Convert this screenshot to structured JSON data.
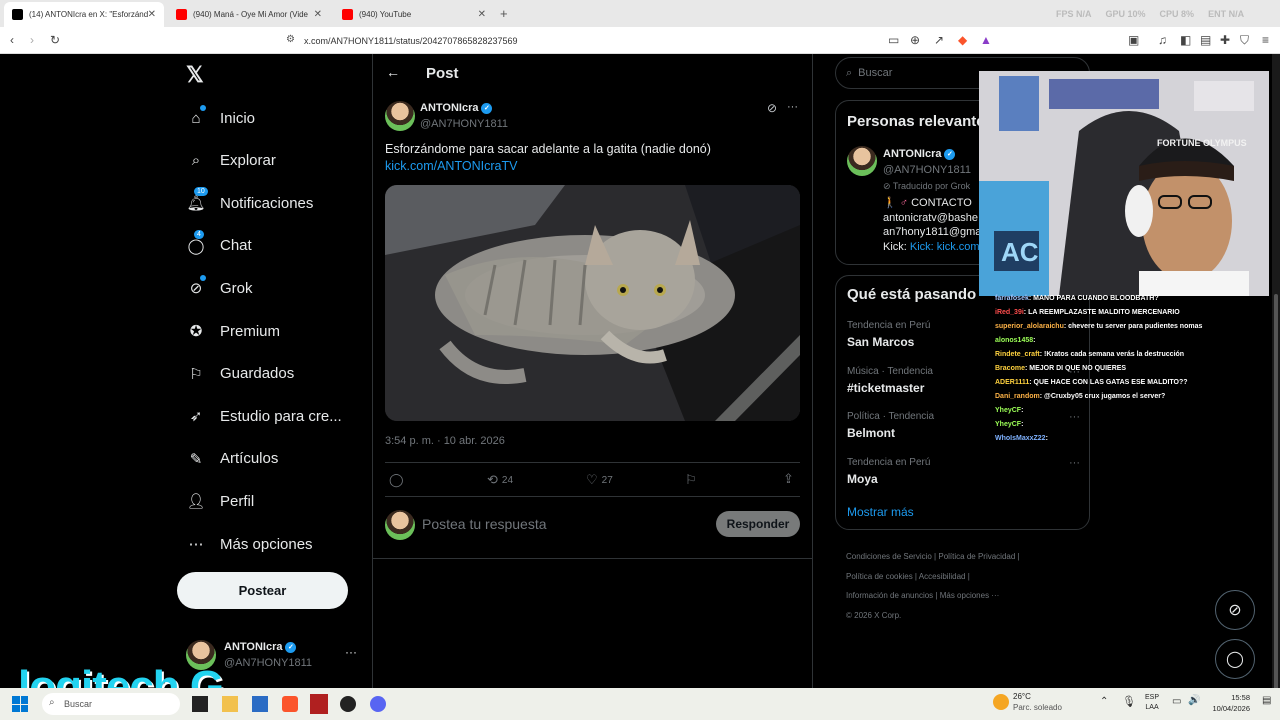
{
  "browser": {
    "tabs": [
      {
        "title": "(14) ANTONIcra en X: \"Esforzánd",
        "active": true,
        "favicon_color": "#000000"
      },
      {
        "title": "(940) Maná - Oye Mi Amor (Vide",
        "active": false,
        "favicon_color": "#ff0000"
      },
      {
        "title": "(940) YouTube",
        "active": false,
        "favicon_color": "#ff0000"
      }
    ],
    "new_tab": "+",
    "url": "x.com/AN7HONY1811/status/2042707865828237569",
    "perf": [
      "FPS N/A",
      "GPU 10%",
      "CPU 8%",
      "ENT N/A"
    ]
  },
  "nav": {
    "items": [
      {
        "label": "Inicio",
        "icon": "home-icon",
        "dot": true
      },
      {
        "label": "Explorar",
        "icon": "search-icon"
      },
      {
        "label": "Notificaciones",
        "icon": "bell-icon",
        "badge": "10"
      },
      {
        "label": "Chat",
        "icon": "chat-icon",
        "badge": "4"
      },
      {
        "label": "Grok",
        "icon": "grok-icon",
        "dot": true
      },
      {
        "label": "Premium",
        "icon": "premium-icon"
      },
      {
        "label": "Guardados",
        "icon": "bookmark-icon"
      },
      {
        "label": "Estudio para cre...",
        "icon": "rocket-icon"
      },
      {
        "label": "Artículos",
        "icon": "article-icon"
      },
      {
        "label": "Perfil",
        "icon": "person-icon"
      },
      {
        "label": "Más opciones",
        "icon": "more-icon"
      }
    ],
    "post_button": "Postear",
    "account": {
      "name": "ANTONIcra",
      "handle": "@AN7HONY1811"
    }
  },
  "post": {
    "header": "Post",
    "author": "ANTONIcra",
    "handle": "@AN7HONY1811",
    "text": "Esforzándome para sacar adelante a la gatita (nadie donó)",
    "link": "kick.com/ANTONIcraTV",
    "timestamp": "3:54 p. m. · 10 abr. 2026",
    "retweets": "24",
    "likes": "27",
    "reply_placeholder": "Postea tu respuesta",
    "reply_button": "Responder"
  },
  "sidebar": {
    "search_placeholder": "Buscar",
    "relevant_title": "Personas relevantes",
    "relevant": {
      "name": "ANTONIcra",
      "handle": "@AN7HONY1811",
      "translated": "Traducido por Grok",
      "bio": [
        "CONTACTO",
        "antonicratv@bashe",
        "an7hony1811@gmai",
        "Kick: kick.com/anto"
      ]
    },
    "trends_title": "Qué está pasando",
    "trends": [
      {
        "category": "Tendencia en Perú",
        "name": "San Marcos"
      },
      {
        "category": "Música · Tendencia",
        "name": "#ticketmaster"
      },
      {
        "category": "Política · Tendencia",
        "name": "Belmont"
      },
      {
        "category": "Tendencia en Perú",
        "name": "Moya"
      }
    ],
    "show_more": "Mostrar más",
    "footer": [
      "Condiciones de Servicio",
      "Política de Privacidad",
      "Política de cookies",
      "Accesibilidad",
      "Información de anuncios",
      "Más opciones ···",
      "© 2026 X Corp."
    ]
  },
  "stream_chat": [
    {
      "user": "farrafosek",
      "msg": ": MANO PARA CUANDO BLOODBATH?",
      "color": "#a0c4ff"
    },
    {
      "user": "iRed_39i",
      "msg": ": LA REEMPLAZASTE MALDITO MERCENARIO",
      "color": "#ff4d4d"
    },
    {
      "user": "superior_alolaraichu",
      "msg": ": chevere tu server para pudientes nomas",
      "color": "#ffb347"
    },
    {
      "user": "alonos1458",
      "msg": ":",
      "color": "#9cff57"
    },
    {
      "user": "Rindete_craft",
      "msg": ": !Kratos cada semana verás la destrucción",
      "color": "#ffd23f"
    },
    {
      "user": "Bracome",
      "msg": ": MEJOR DI QUE NO QUIERES",
      "color": "#ffd23f"
    },
    {
      "user": "ADER1111",
      "msg": ": QUE HACE CON LAS GATAS ESE MALDITO??",
      "color": "#ffd23f"
    },
    {
      "user": "Dani_random",
      "msg": ": @Cruxby05 crux jugamos el server?",
      "color": "#ffb347"
    },
    {
      "user": "YheyCF",
      "msg": ":",
      "color": "#9cff57"
    },
    {
      "user": "YheyCF",
      "msg": ":",
      "color": "#9cff57"
    },
    {
      "user": "WhoIsMaxxZ22",
      "msg": ":",
      "color": "#7fb2ff"
    }
  ],
  "cam": {
    "cap_text": "FORTUNE OLYMPUS",
    "block_text": "AC"
  },
  "taskbar": {
    "search": "Buscar",
    "weather_temp": "26°C",
    "weather_desc": "Parc. soleado",
    "lang": "ESP",
    "lang2": "LAA",
    "time": "15:58",
    "date": "10/04/2026"
  },
  "overlay_logo": "logitech G"
}
